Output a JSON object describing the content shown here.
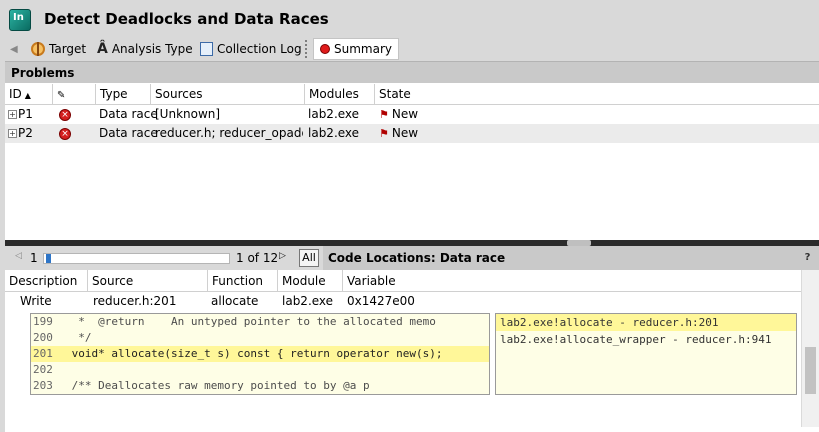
{
  "window": {
    "title": "Detect Deadlocks and Data Races",
    "app_icon": "inspector-icon"
  },
  "toolbar": {
    "items": [
      {
        "label": "Target",
        "icon": "target-icon"
      },
      {
        "label": "Analysis Type",
        "icon": "analysis-type-icon"
      },
      {
        "label": "Collection Log",
        "icon": "collection-log-icon"
      },
      {
        "label": "Summary",
        "icon": "summary-icon",
        "selected": true
      }
    ]
  },
  "problems": {
    "title": "Problems",
    "columns": [
      "ID",
      "",
      "Type",
      "Sources",
      "Modules",
      "State"
    ],
    "rows": [
      {
        "id": "P1",
        "type": "Data race",
        "sources": "[Unknown]",
        "modules": "lab2.exe",
        "state": "New"
      },
      {
        "id": "P2",
        "type": "Data race",
        "sources": "reducer.h; reducer_opadd.h",
        "modules": "lab2.exe",
        "state": "New"
      }
    ]
  },
  "navigator": {
    "current": "1",
    "of_text": "1 of 12",
    "all_label": "All"
  },
  "code_locations": {
    "title": "Code Locations: Data race",
    "columns": [
      "Description",
      "Source",
      "Function",
      "Module",
      "Variable"
    ],
    "rows": [
      {
        "description": "Write",
        "source": "reducer.h:201",
        "function": "allocate",
        "module": "lab2.exe",
        "variable": "0x1427e00"
      }
    ],
    "code": [
      {
        "num": "199",
        "text": "  *  @return    An untyped pointer to the allocated memo"
      },
      {
        "num": "200",
        "text": "  */"
      },
      {
        "num": "201",
        "text": " void* allocate(size_t s) const { return operator new(s);",
        "highlight": true
      },
      {
        "num": "202",
        "text": ""
      },
      {
        "num": "203",
        "text": " /** Deallocates raw memory pointed to by @a p"
      }
    ],
    "stack": [
      {
        "text": "lab2.exe!allocate - reducer.h:201",
        "highlight": true
      },
      {
        "text": "lab2.exe!allocate_wrapper - reducer.h:941"
      }
    ]
  },
  "colors": {
    "highlight": "#fff799",
    "code_bg": "#fefee6",
    "header_bg": "#c9c9c9",
    "toolbar_bg": "#d9d9d9",
    "error": "#d41f1f"
  }
}
